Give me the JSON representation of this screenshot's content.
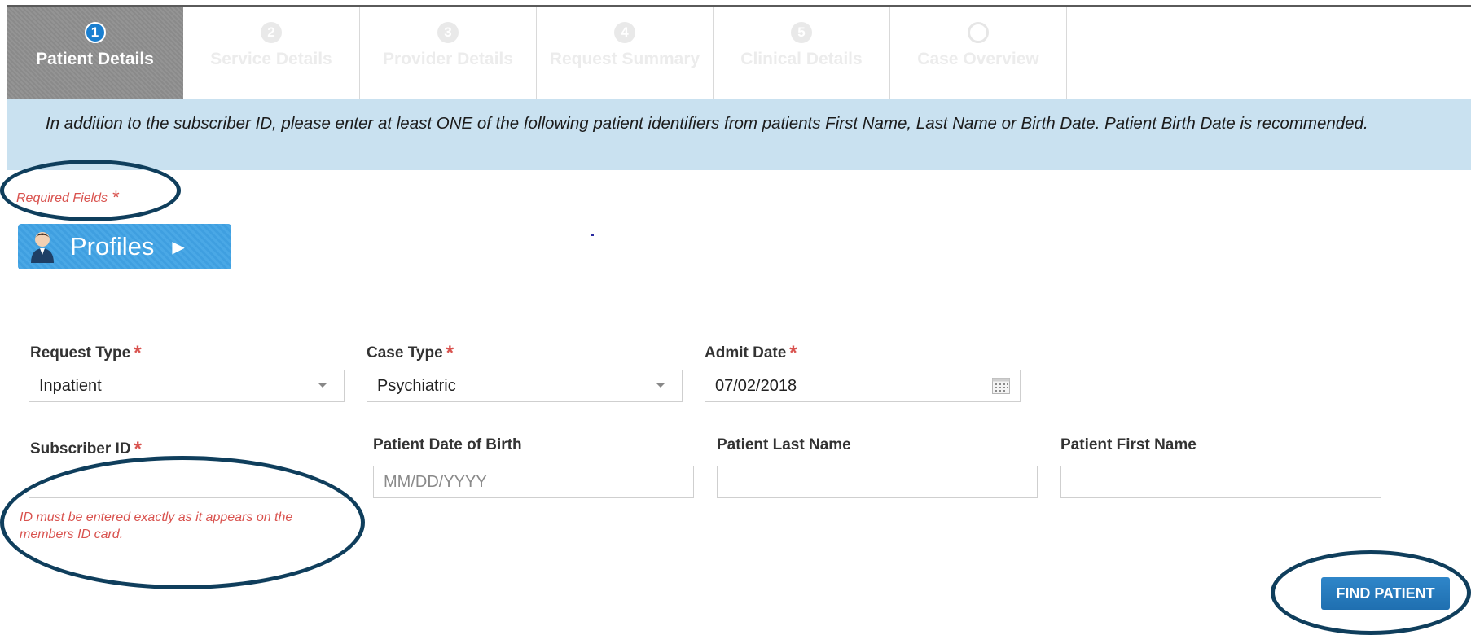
{
  "wizard": {
    "steps": [
      {
        "number": "1",
        "label": "Patient Details"
      },
      {
        "number": "2",
        "label": "Service Details"
      },
      {
        "number": "3",
        "label": "Provider Details"
      },
      {
        "number": "4",
        "label": "Request Summary"
      },
      {
        "number": "5",
        "label": "Clinical Details"
      },
      {
        "number": "",
        "label": "Case Overview"
      }
    ],
    "active_step": 1,
    "active_color": "#1a7fd0"
  },
  "info_banner": {
    "text": "In addition to the subscriber ID, please enter at least ONE of the following patient identifiers from patients First Name, Last Name or Birth Date. Patient Birth Date is recommended."
  },
  "required_note": {
    "text": "Required Fields",
    "star": "*"
  },
  "profiles_button": {
    "label": "Profiles",
    "icon": "user-avatar-icon",
    "arrow": "▶"
  },
  "form": {
    "request_type": {
      "label": "Request Type",
      "star": "*",
      "value": "Inpatient"
    },
    "case_type": {
      "label": "Case Type",
      "star": "*",
      "value": "Psychiatric"
    },
    "admit_date": {
      "label": "Admit Date",
      "star": "*",
      "value": "07/02/2018",
      "icon": "calendar-icon"
    },
    "subscriber_id": {
      "label": "Subscriber ID",
      "star": "*",
      "value": "",
      "hint": "ID must be entered exactly as it appears on the members ID card."
    },
    "patient_dob": {
      "label": "Patient Date of Birth",
      "value": "",
      "placeholder": "MM/DD/YYYY"
    },
    "patient_last_name": {
      "label": "Patient Last Name",
      "value": ""
    },
    "patient_first_name": {
      "label": "Patient First Name",
      "value": ""
    }
  },
  "find_patient_button": {
    "label": "FIND PATIENT"
  },
  "colors": {
    "required": "#d9534f",
    "banner": "#c9e1f0",
    "button": "#1f6fb0",
    "annotation_ring": "#0f3e5c"
  }
}
